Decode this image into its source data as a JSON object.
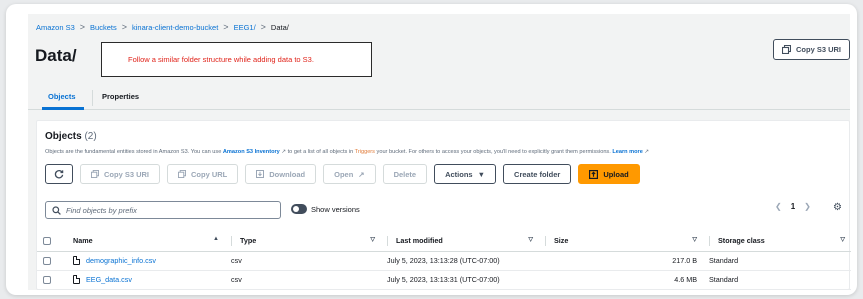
{
  "breadcrumb": {
    "items": [
      "Amazon S3",
      "Buckets",
      "kinara-client-demo-bucket",
      "EEG1/"
    ],
    "current": "Data/",
    "separator": ">"
  },
  "page_title": "Data/",
  "annotation_text": "Follow a similar folder structure while adding data to S3.",
  "copy_s3_uri_top": "Copy S3 URI",
  "tabs": [
    {
      "label": "Objects",
      "active": true
    },
    {
      "label": "Properties",
      "active": false
    }
  ],
  "objects_panel": {
    "title": "Objects",
    "count": "(2)",
    "description_pre": "Objects are the fundamental entities stored in Amazon S3. You can use",
    "inventory_link": "Amazon S3 Inventory",
    "description_mid1": "to get a list of all objects in",
    "trigger_text": "Triggers",
    "description_mid2": "your bucket. For others to access your objects, you'll need to explicitly grant them permissions.",
    "learn_more": "Learn more"
  },
  "toolbar": {
    "refresh_icon": "refresh-icon",
    "copy_s3_uri": "Copy S3 URI",
    "copy_url": "Copy URL",
    "download": "Download",
    "open": "Open",
    "delete": "Delete",
    "actions": "Actions",
    "create_folder": "Create folder",
    "upload": "Upload"
  },
  "search": {
    "placeholder": "Find objects by prefix"
  },
  "show_versions_label": "Show versions",
  "pagination": {
    "page": "1"
  },
  "table": {
    "columns": [
      "Name",
      "Type",
      "Last modified",
      "Size",
      "Storage class"
    ],
    "rows": [
      {
        "name": "demographic_info.csv",
        "type": "csv",
        "last_modified": "July 5, 2023, 13:13:28 (UTC-07:00)",
        "size": "217.0 B",
        "storage_class": "Standard"
      },
      {
        "name": "EEG_data.csv",
        "type": "csv",
        "last_modified": "July 5, 2023, 13:13:31 (UTC-07:00)",
        "size": "4.6 MB",
        "storage_class": "Standard"
      }
    ]
  },
  "colors": {
    "link": "#0972d3",
    "primary_button": "#ff9900",
    "annotation_text": "#e0231a"
  }
}
